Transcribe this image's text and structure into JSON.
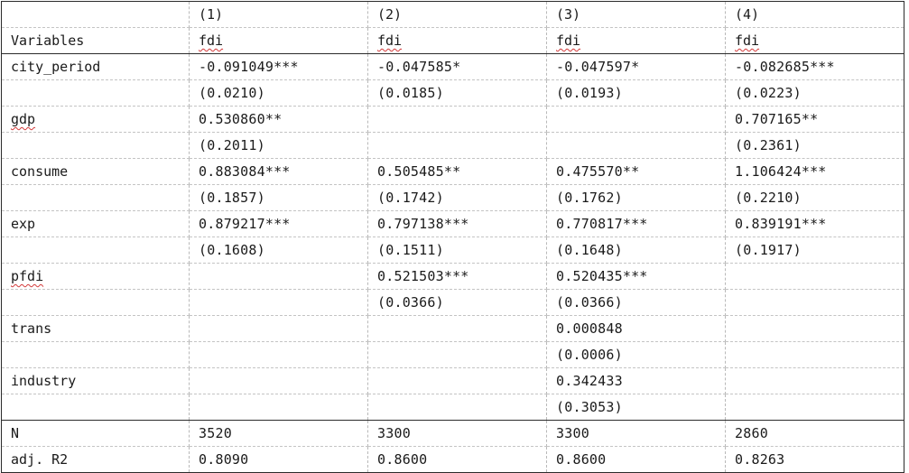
{
  "header": {
    "model_numbers": [
      "",
      "(1)",
      "(2)",
      "(3)",
      "(4)"
    ],
    "dependent_label": "Variables",
    "dependent_vars": [
      "fdi",
      "fdi",
      "fdi",
      "fdi"
    ]
  },
  "rows": [
    {
      "var": "city_period",
      "coef": [
        "-0.091049***",
        "-0.047585*",
        "-0.047597*",
        "-0.082685***"
      ],
      "se": [
        "(0.0210)",
        "(0.0185)",
        "(0.0193)",
        "(0.0223)"
      ]
    },
    {
      "var": "gdp",
      "coef": [
        "0.530860**",
        "",
        "",
        "0.707165**"
      ],
      "se": [
        "(0.2011)",
        "",
        "",
        "(0.2361)"
      ]
    },
    {
      "var": "consume",
      "coef": [
        "0.883084***",
        "0.505485**",
        "0.475570**",
        "1.106424***"
      ],
      "se": [
        "(0.1857)",
        "(0.1742)",
        "(0.1762)",
        "(0.2210)"
      ]
    },
    {
      "var": "exp",
      "coef": [
        "0.879217***",
        "0.797138***",
        "0.770817***",
        "0.839191***"
      ],
      "se": [
        "(0.1608)",
        "(0.1511)",
        "(0.1648)",
        "(0.1917)"
      ]
    },
    {
      "var": "pfdi",
      "coef": [
        "",
        "0.521503***",
        "0.520435***",
        ""
      ],
      "se": [
        "",
        "(0.0366)",
        "(0.0366)",
        ""
      ]
    },
    {
      "var": "trans",
      "coef": [
        "",
        "",
        "0.000848",
        ""
      ],
      "se": [
        "",
        "",
        "(0.0006)",
        ""
      ]
    },
    {
      "var": "industry",
      "coef": [
        "",
        "",
        "0.342433",
        ""
      ],
      "se": [
        "",
        "",
        "(0.3053)",
        ""
      ]
    }
  ],
  "stats": [
    {
      "label": "N",
      "values": [
        "3520",
        "3300",
        "3300",
        "2860"
      ]
    },
    {
      "label": "adj. R2",
      "values": [
        "0.8090",
        "0.8600",
        "0.8600",
        "0.8263"
      ]
    }
  ]
}
